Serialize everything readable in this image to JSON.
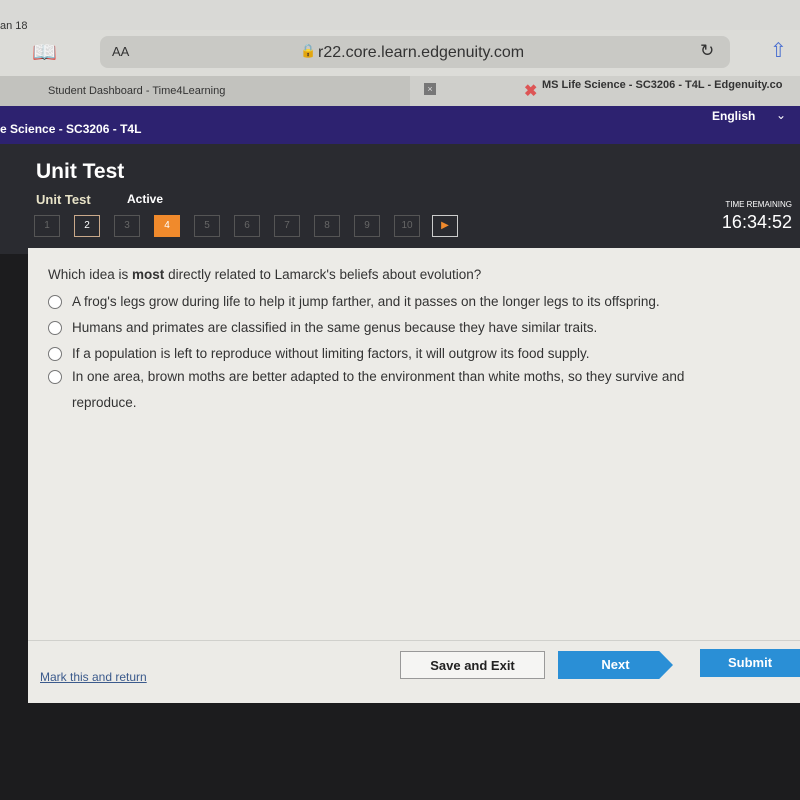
{
  "browser": {
    "date": "an 18",
    "text_size": "AA",
    "url": "r22.core.learn.edgenuity.com",
    "tabs": [
      {
        "label": "Student Dashboard - Time4Learning"
      },
      {
        "label": "MS Life Science - SC3206 - T4L - Edgenuity.co"
      }
    ]
  },
  "header": {
    "course": "e Science - SC3206 - T4L",
    "language": "English",
    "title": "Unit Test",
    "subtitle": "Unit Test",
    "status": "Active",
    "time_label": "TIME REMAINING",
    "time": "16:34:52"
  },
  "nav": {
    "questions": [
      "1",
      "2",
      "3",
      "4",
      "5",
      "6",
      "7",
      "8",
      "9",
      "10"
    ],
    "current": "4",
    "visited": [
      "2"
    ]
  },
  "question": {
    "prefix": "Which idea is ",
    "bold": "most",
    "suffix": " directly related to Lamarck's beliefs about evolution?",
    "options": [
      "A frog's legs grow during life to help it jump farther, and it passes on the longer legs to its offspring.",
      "Humans and primates are classified in the same genus because they have similar traits.",
      "If a population is left to reproduce without limiting factors, it will outgrow its food supply.",
      "In one area, brown moths are better adapted to the environment than white moths, so they survive and reproduce."
    ]
  },
  "footer": {
    "mark": "Mark this and return",
    "save": "Save and Exit",
    "next": "Next",
    "submit": "Submit"
  },
  "colors": {
    "accent": "#f08a2c",
    "button_blue": "#2a8fd6",
    "header_purple": "#2d2270"
  }
}
